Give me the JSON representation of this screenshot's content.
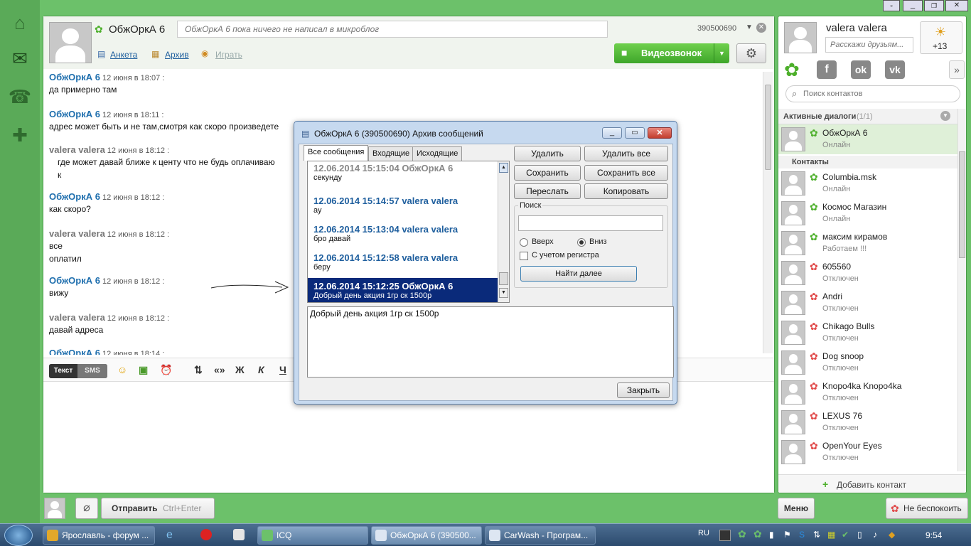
{
  "chat": {
    "contact_name": "ОбжОркА 6",
    "status_placeholder": "ОбжОркА 6 пока ничего не написал в микроблог",
    "contact_uin": "390500690",
    "links": {
      "profile": "Анкета",
      "archive": "Архив",
      "play": "Играть"
    },
    "video_call": "Видеозвонок",
    "messages": [
      {
        "author": "ОбжОркА 6",
        "mine": false,
        "time": "12 июня в 18:07 :",
        "lines": [
          "да примерно там"
        ]
      },
      {
        "author": "ОбжОркА 6",
        "mine": false,
        "time": "12 июня в 18:11 :",
        "lines": [
          "адрес может быть и не там,смотря как скоро произведете"
        ]
      },
      {
        "author": "valera valera",
        "mine": true,
        "time": "12 июня в 18:12 :",
        "lines": [
          "где может давай ближе к центу что не будь оплачиваю",
          "к"
        ]
      },
      {
        "author": "ОбжОркА 6",
        "mine": false,
        "time": "12 июня в 18:12 :",
        "lines": [
          "как скоро?"
        ]
      },
      {
        "author": "valera valera",
        "mine": true,
        "time": "12 июня в 18:12 :",
        "lines": [
          "все",
          "оплатил"
        ]
      },
      {
        "author": "ОбжОркА 6",
        "mine": false,
        "time": "12 июня в 18:12 :",
        "lines": [
          "вижу"
        ]
      },
      {
        "author": "valera valera",
        "mine": true,
        "time": "12 июня в 18:12 :",
        "lines": [
          "давай адреса"
        ]
      },
      {
        "author": "ОбжОркА 6",
        "mine": false,
        "time": "12 июня в 18:14 :",
        "lines": [
          ""
        ]
      }
    ],
    "toolbar": {
      "text_tab": "Текст",
      "sms_tab": "SMS",
      "bold": "Ж",
      "italic": "К",
      "underline": "Ч",
      "quote": "«»"
    },
    "send_button": "Отправить",
    "send_hint": "Ctrl+Enter"
  },
  "user": {
    "name": "valera valera",
    "status_placeholder": "Расскажи друзьям...",
    "weather": "+13"
  },
  "contacts_panel": {
    "search_placeholder": "Поиск контактов",
    "active_header": "Активные диалоги",
    "active_count": "(1/1)",
    "active": [
      {
        "name": "ОбжОркА 6",
        "status": "Онлайн"
      }
    ],
    "contacts_header": "Контакты",
    "contacts": [
      {
        "name": "Columbia.msk",
        "status": "Онлайн",
        "online": true
      },
      {
        "name": "Космос Магазин",
        "status": "Онлайн",
        "online": true
      },
      {
        "name": "максим кирамов",
        "status": "Работаем !!!",
        "online": true
      },
      {
        "name": "605560",
        "status": "Отключен",
        "online": false
      },
      {
        "name": "Andri",
        "status": "Отключен",
        "online": false
      },
      {
        "name": "Chikago Bulls",
        "status": "Отключен",
        "online": false
      },
      {
        "name": "Dog snoop",
        "status": "Отключен",
        "online": false
      },
      {
        "name": "Knopo4ka Knopo4ka",
        "status": "Отключен",
        "online": false
      },
      {
        "name": "LEXUS 76",
        "status": "Отключен",
        "online": false
      },
      {
        "name": "OpenYour Eyes",
        "status": "Отключен",
        "online": false
      }
    ],
    "add_contact": "Добавить контакт",
    "menu": "Меню",
    "dnd": "Не беспокоить"
  },
  "archive": {
    "title": "ОбжОркА 6 (390500690) Архив сообщений",
    "tabs": [
      "Все сообщения",
      "Входящие",
      "Исходящие"
    ],
    "items": [
      {
        "head": "12.06.2014 15:15:04 ОбжОркА 6",
        "body": "секунду",
        "selected": false
      },
      {
        "head": "12.06.2014 15:14:57 valera valera",
        "body": "ау",
        "selected": false
      },
      {
        "head": "12.06.2014 15:13:04 valera valera",
        "body": "бро давай",
        "selected": false
      },
      {
        "head": "12.06.2014 15:12:58 valera valera",
        "body": "беру",
        "selected": false
      },
      {
        "head": "12.06.2014 15:12:25 ОбжОркА 6",
        "body": "Добрый день акция 1гр ск 1500р",
        "selected": true
      }
    ],
    "buttons": {
      "delete": "Удалить",
      "delete_all": "Удалить все",
      "save": "Сохранить",
      "save_all": "Сохранить все",
      "forward": "Переслать",
      "copy": "Копировать"
    },
    "search_group": "Поиск",
    "up": "Вверх",
    "down": "Вниз",
    "case": "С учетом регистра",
    "find_next": "Найти далее",
    "preview": "Добрый день акция 1гр ск 1500р",
    "close": "Закрыть"
  },
  "taskbar": {
    "tasks": [
      "Ярославль - форум ...",
      "ICQ",
      "ОбжОркА 6 (390500...",
      "CarWash - Програм..."
    ],
    "lang": "RU",
    "clock": "9:54"
  },
  "colors": {
    "green": "#6cc16a",
    "link": "#1f6fae",
    "selection": "#0a2a7a"
  }
}
